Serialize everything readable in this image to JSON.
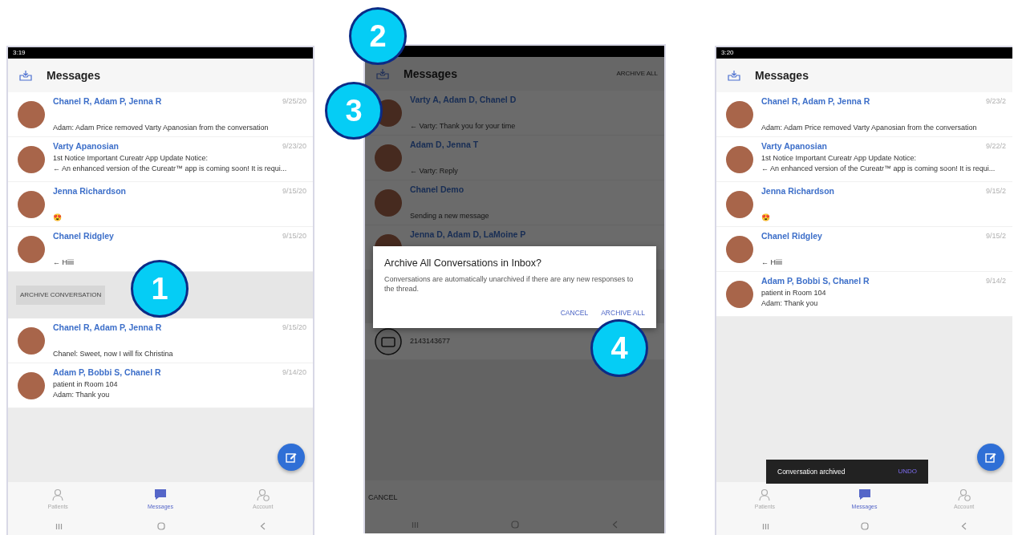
{
  "phones": [
    {
      "status_time": "3:19",
      "title": "Messages",
      "dimmed": false,
      "fab": true,
      "rows": [
        {
          "kind": "conversation",
          "name": "Chanel R, Adam P, Jenna R",
          "date": "9/25/20",
          "lines": [
            "Adam: Adam Price removed Varty Apanosian from the conversation"
          ]
        },
        {
          "kind": "conversation",
          "name": "Varty Apanosian",
          "date": "9/23/20",
          "lines": [
            "1st Notice Important Cureatr App Update Notice:",
            "← An enhanced version of the Cureatr™ app is coming soon! It is requi..."
          ]
        },
        {
          "kind": "conversation",
          "name": "Jenna Richardson",
          "date": "9/15/20",
          "lines": [
            "😍"
          ]
        },
        {
          "kind": "conversation",
          "name": "Chanel Ridgley",
          "date": "9/15/20",
          "lines": [
            "← Hiiii"
          ]
        },
        {
          "kind": "swipe_action",
          "label": "ARCHIVE CONVERSATION"
        },
        {
          "kind": "conversation",
          "name": "Chanel R, Adam P, Jenna R",
          "date": "9/15/20",
          "lines": [
            "Chanel: Sweet, now I will fix Christina"
          ]
        },
        {
          "kind": "conversation",
          "name": "Adam P, Bobbi S, Chanel R",
          "date": "9/14/20",
          "lines": [
            "patient in Room 104",
            "Adam: Thank you"
          ]
        }
      ],
      "nav": [
        {
          "label": "Patients",
          "selected": false
        },
        {
          "label": "Messages",
          "selected": true
        },
        {
          "label": "Account",
          "selected": false
        }
      ]
    },
    {
      "title": "Messages",
      "header_action": "ARCHIVE ALL",
      "dimmed": true,
      "fab": false,
      "rows": [
        {
          "kind": "conversation",
          "name": "Varty A, Adam D, Chanel D",
          "lines": [
            "← Varty: Thank you for your time"
          ]
        },
        {
          "kind": "conversation",
          "name": "Adam D, Jenna T",
          "lines": [
            "← Varty: Reply"
          ]
        },
        {
          "kind": "conversation",
          "name": "Chanel Demo",
          "lines": [
            "Sending a new message"
          ]
        },
        {
          "kind": "conversation",
          "name": "Jenna D, Adam D, LaMoine P",
          "lines": []
        },
        {
          "kind": "contact",
          "lines": [
            "2143143677"
          ]
        }
      ],
      "bottom_action": "CANCEL",
      "dialog": {
        "title": "Archive All Conversations in Inbox?",
        "body": "Conversations are automatically unarchived if there are any new responses to the thread.",
        "buttons": [
          "CANCEL",
          "ARCHIVE ALL"
        ]
      }
    },
    {
      "status_time": "3:20",
      "title": "Messages",
      "dimmed": false,
      "fab": true,
      "rows": [
        {
          "kind": "conversation",
          "name": "Chanel R, Adam P, Jenna R",
          "date": "9/23/2",
          "lines": [
            "Adam: Adam Price removed Varty Apanosian from the conversation"
          ]
        },
        {
          "kind": "conversation",
          "name": "Varty Apanosian",
          "date": "9/22/2",
          "lines": [
            "1st Notice Important Cureatr App Update Notice:",
            "← An enhanced version of the Cureatr™ app is coming soon! It is requi..."
          ]
        },
        {
          "kind": "conversation",
          "name": "Jenna Richardson",
          "date": "9/15/2",
          "lines": [
            "😍"
          ]
        },
        {
          "kind": "conversation",
          "name": "Chanel Ridgley",
          "date": "9/15/2",
          "lines": [
            "← Hiiii"
          ]
        },
        {
          "kind": "conversation",
          "name": "Adam P, Bobbi S, Chanel R",
          "date": "9/14/2",
          "lines": [
            "patient in Room 104",
            "Adam: Thank you"
          ]
        }
      ],
      "snackbar": {
        "text": "Conversation archived",
        "action": "UNDO"
      },
      "nav": [
        {
          "label": "Patients",
          "selected": false
        },
        {
          "label": "Messages",
          "selected": true
        },
        {
          "label": "Account",
          "selected": false
        }
      ]
    }
  ],
  "callouts": [
    "1",
    "2",
    "3",
    "4"
  ]
}
